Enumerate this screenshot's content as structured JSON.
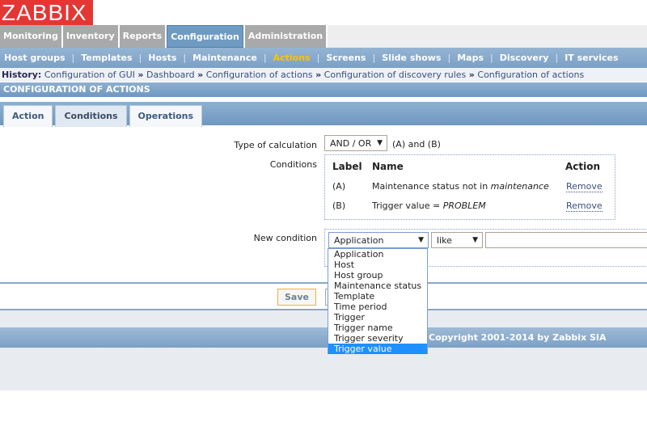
{
  "logo": "ZABBIX",
  "main_menu": [
    "Monitoring",
    "Inventory",
    "Reports",
    "Configuration",
    "Administration"
  ],
  "main_menu_active": "Configuration",
  "sub_menu": [
    "Host groups",
    "Templates",
    "Hosts",
    "Maintenance",
    "Actions",
    "Screens",
    "Slide shows",
    "Maps",
    "Discovery",
    "IT services"
  ],
  "history": {
    "label": "History:",
    "items": [
      "Configuration of GUI",
      "Dashboard",
      "Configuration of actions",
      "Configuration of discovery rules",
      "Configuration of actions"
    ],
    "sep": "»"
  },
  "page_title": "CONFIGURATION OF ACTIONS",
  "tabs": [
    "Action",
    "Conditions",
    "Operations"
  ],
  "form": {
    "type_label": "Type of calculation",
    "type_value": "AND / OR",
    "type_expr": "(A) and (B)",
    "conditions_label": "Conditions",
    "cond_headers": [
      "Label",
      "Name",
      "Action"
    ],
    "conditions": [
      {
        "label": "(A)",
        "name": "Maintenance status not in ",
        "name_em": "maintenance",
        "action": "Remove"
      },
      {
        "label": "(B)",
        "name": "Trigger value = ",
        "name_em": "PROBLEM",
        "action": "Remove"
      }
    ],
    "new_condition_label": "New condition",
    "new_condition_type": "Application",
    "new_condition_operator": "like",
    "new_condition_value": "",
    "dropdown_options": [
      "Application",
      "Host",
      "Host group",
      "Maintenance status",
      "Template",
      "Time period",
      "Trigger",
      "Trigger name",
      "Trigger severity",
      "Trigger value"
    ],
    "dropdown_highlighted": "Trigger value",
    "save": "Save"
  },
  "footer": "Copyright 2001-2014 by Zabbix SIA"
}
